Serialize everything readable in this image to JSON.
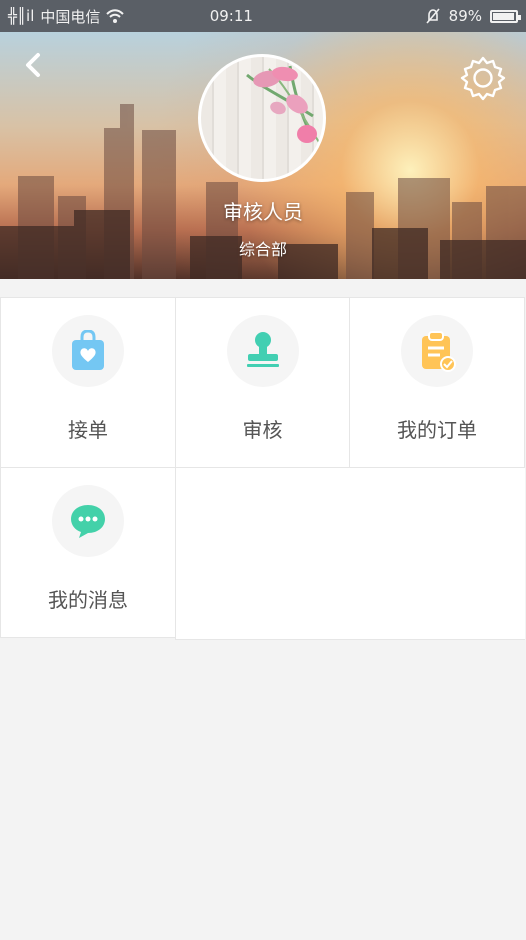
{
  "status_bar": {
    "signal_text": "╬║il",
    "carrier": "中国电信",
    "time": "09:11",
    "battery": "89%",
    "battery_level": 0.89
  },
  "profile": {
    "name": "审核人员",
    "department": "综合部"
  },
  "menu": [
    {
      "label": "接单",
      "icon": "shopping-bag-heart-icon",
      "color": "#74c7f3"
    },
    {
      "label": "审核",
      "icon": "stamp-icon",
      "color": "#42cfb2"
    },
    {
      "label": "我的订单",
      "icon": "clipboard-check-icon",
      "color": "#ffc457"
    },
    {
      "label": "我的消息",
      "icon": "message-bubble-icon",
      "color": "#43d1a9"
    }
  ]
}
